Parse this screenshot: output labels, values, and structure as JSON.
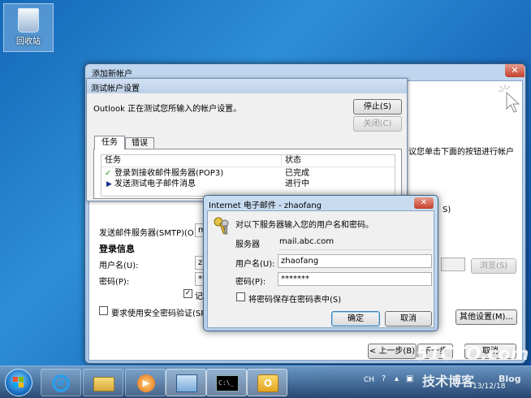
{
  "desktop": {
    "recycle_bin_label": "回收站"
  },
  "wizard": {
    "title": "添加新帐户",
    "right_text": "议您单击下面的按钮进行帐户",
    "partial_s": "S)",
    "outgoing_label": "发送邮件服务器(SMTP)(O):",
    "outgoing_value": "ma",
    "login_section": "登录信息",
    "username_label": "用户名(U):",
    "username_value": "zh",
    "password_label": "密码(P):",
    "password_value": "**",
    "remember_label": "记住",
    "spa_label": "要求使用安全密码验证(SPA)",
    "browse_button": "浏览(S)",
    "more_settings_button": "其他设置(M)...",
    "back_button": "< 上一步(B)",
    "next_button": "下一步",
    "cancel_button": "取消"
  },
  "test_dialog": {
    "title": "测试帐户设置",
    "message": "Outlook 正在测试您所输入的帐户设置。",
    "stop_button": "停止(S)",
    "close_button": "关闭(C)",
    "tabs": [
      "任务",
      "错误"
    ],
    "columns": {
      "task": "任务",
      "status": "状态"
    },
    "rows": [
      {
        "task": "登录到接收邮件服务器(POP3)",
        "status": "已完成",
        "icon": "check-icon"
      },
      {
        "task": "发送测试电子邮件消息",
        "status": "进行中",
        "icon": "arrow-right-icon"
      }
    ]
  },
  "login_dialog": {
    "title": "Internet 电子邮件 - zhaofang",
    "prompt": "对以下服务器输入您的用户名和密码。",
    "server_label": "服务器",
    "server_value": "mail.abc.com",
    "username_label": "用户名(U):",
    "username_value": "zhaofang",
    "password_label": "密码(P):",
    "password_value": "*******",
    "save_password_label": "将密码保存在密码表中(S)",
    "ok_button": "确定",
    "cancel_button": "取消"
  },
  "taskbar": {
    "tray_lang": "CH",
    "date_partial": "13/12/18",
    "apps": [
      "ie-icon",
      "explorer-icon",
      "media-player-icon",
      "control-panel-icon",
      "cmd-icon",
      "outlook-icon"
    ]
  },
  "watermark": {
    "site": "51CTO.com",
    "sub": "技术博客",
    "blog": "Blog"
  }
}
